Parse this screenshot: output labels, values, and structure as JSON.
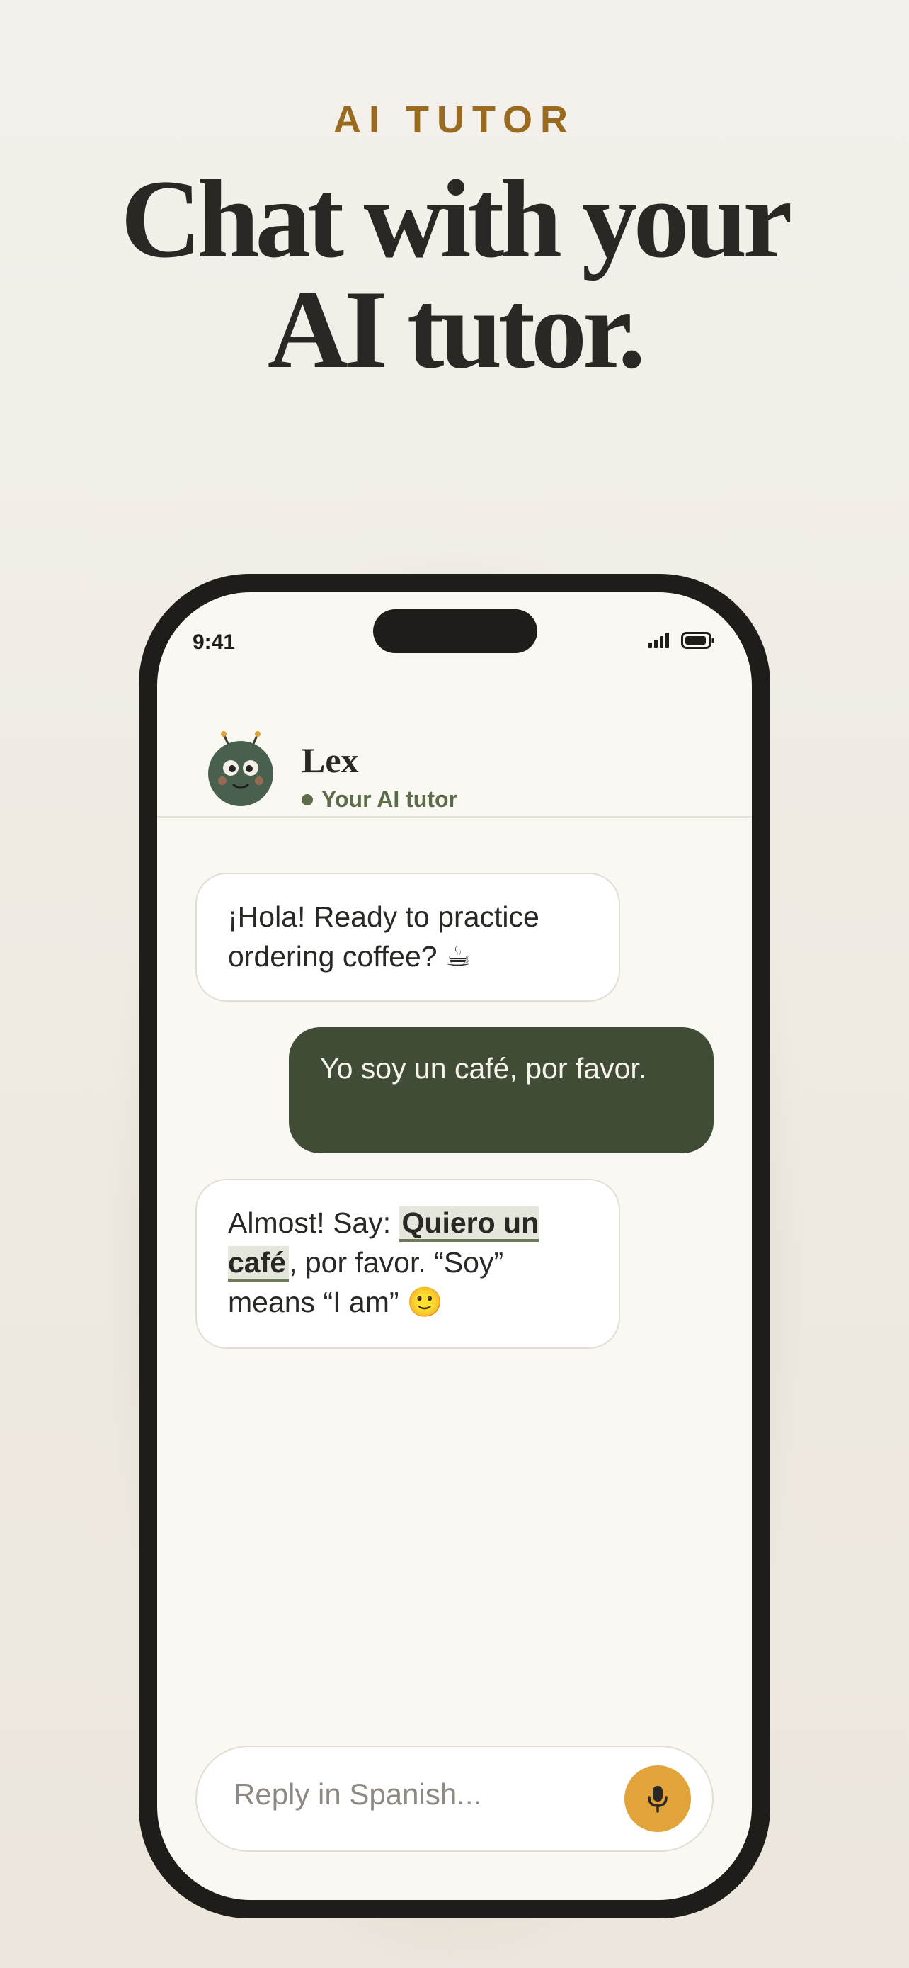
{
  "hero": {
    "eyebrow": "AI TUTOR",
    "headline_line1": "Chat with your",
    "headline_line2": "AI tutor."
  },
  "status_bar": {
    "time": "9:41",
    "icons": [
      "signal-icon",
      "battery-icon"
    ]
  },
  "chat_header": {
    "name": "Lex",
    "subtitle": "Your AI tutor",
    "avatar_icon": "robot-avatar-icon",
    "status_dot_color": "#5c6b48"
  },
  "messages": [
    {
      "sender": "tutor",
      "text": "¡Hola! Ready to practice ordering coffee? ☕"
    },
    {
      "sender": "user",
      "text": "Yo soy un café, por favor."
    },
    {
      "sender": "tutor",
      "prefix": "Almost! Say: ",
      "highlight": "Quiero un café",
      "suffix": ", por favor. “Soy” means “I am” 🙂"
    }
  ],
  "composer": {
    "placeholder": "Reply in Spanish...",
    "value": "",
    "mic_icon": "microphone-icon"
  },
  "colors": {
    "accent": "#9a6a1f",
    "user_bubble": "#414c36",
    "mic_button": "#e1a33a",
    "phone_frame": "#1e1d1a",
    "screen_background": "#faf8f3"
  }
}
